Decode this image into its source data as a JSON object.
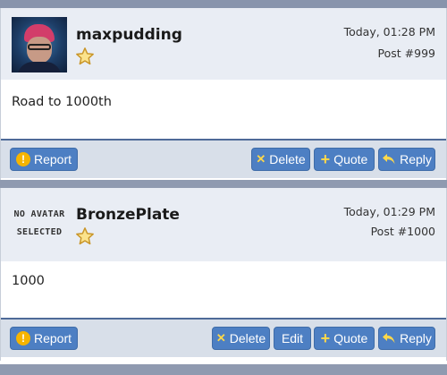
{
  "posts": [
    {
      "username": "maxpudding",
      "time": "Today, 01:28 PM",
      "post_number": "Post #999",
      "body": "Road to 1000th",
      "avatar": "user-avatar",
      "actions": {
        "report": "Report",
        "delete": "Delete",
        "quote": "Quote",
        "reply": "Reply"
      }
    },
    {
      "username": "BronzePlate",
      "time": "Today, 01:29 PM",
      "post_number": "Post #1000",
      "body": "1000",
      "avatar_placeholder_line1": "NO AVATAR",
      "avatar_placeholder_line2": "SELECTED",
      "actions": {
        "report": "Report",
        "delete": "Delete",
        "edit": "Edit",
        "quote": "Quote",
        "reply": "Reply"
      }
    }
  ],
  "icons": {
    "rank": "star-icon",
    "report": "warning-icon",
    "delete": "x-icon",
    "quote": "plus-icon",
    "reply": "reply-arrow-icon"
  },
  "colors": {
    "button_bg": "#4d7fc3",
    "footer_border": "#4e6a98",
    "header_bg": "#e9edf4",
    "page_bg": "#8f9ab0",
    "star": "#f5c518"
  }
}
